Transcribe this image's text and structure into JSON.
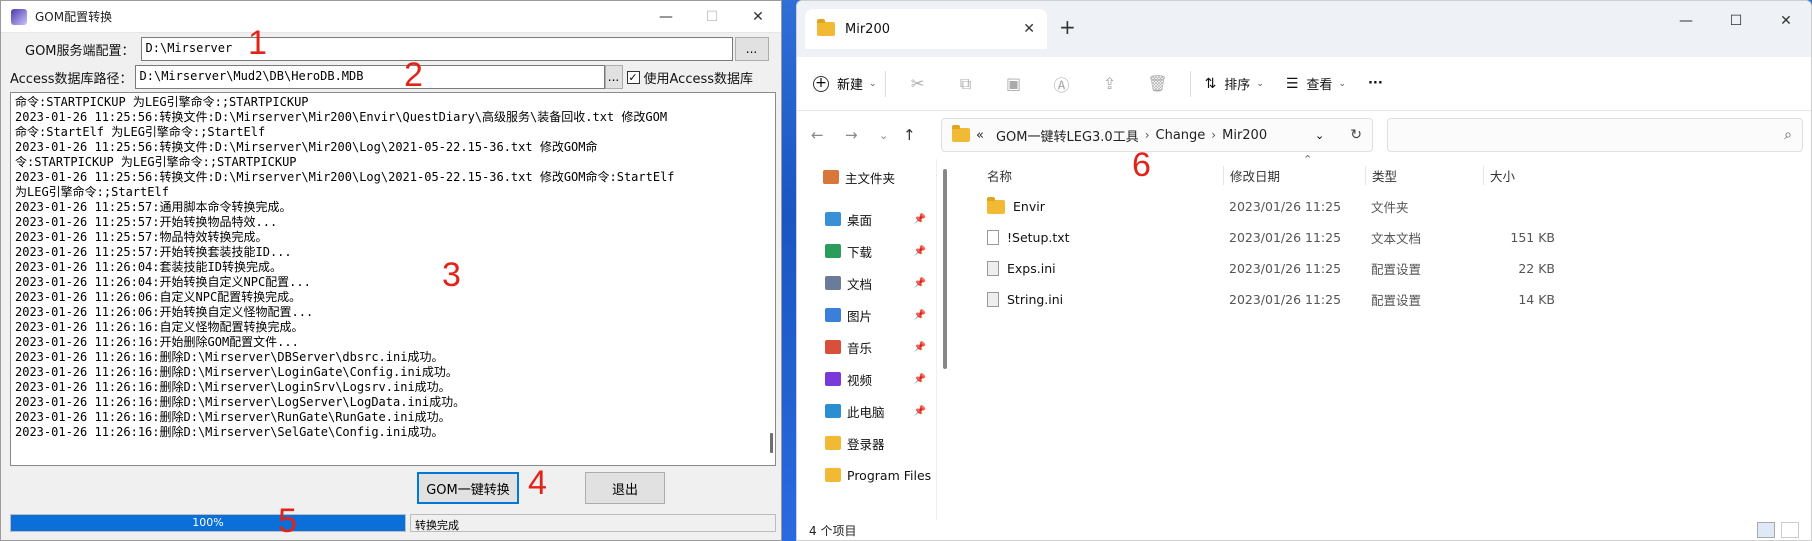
{
  "left_window": {
    "title": "GOM配置转换",
    "caption_minimize": "—",
    "caption_maximize": "☐",
    "caption_close": "✕",
    "server_config_label": "GOM服务端配置：",
    "server_config_value": "D:\\Mirserver",
    "browse_label": "...",
    "access_label": "Access数据库路径：",
    "access_value": "D:\\Mirserver\\Mud2\\DB\\HeroDB.MDB",
    "access_browse_label": "...",
    "use_access_checked": "✓",
    "use_access_label": "使用Access数据库",
    "log_lines": [
      "命令:STARTPICKUP 为LEG引擎命令:;STARTPICKUP",
      "2023-01-26 11:25:56:转换文件:D:\\Mirserver\\Mir200\\Envir\\QuestDiary\\高级服务\\装备回收.txt 修改GOM",
      "命令:StartElf 为LEG引擎命令:;StartElf",
      "2023-01-26 11:25:56:转换文件:D:\\Mirserver\\Mir200\\Log\\2021-05-22.15-36.txt 修改GOM命",
      "令:STARTPICKUP 为LEG引擎命令:;STARTPICKUP",
      "2023-01-26 11:25:56:转换文件:D:\\Mirserver\\Mir200\\Log\\2021-05-22.15-36.txt 修改GOM命令:StartElf",
      "为LEG引擎命令:;StartElf",
      "2023-01-26 11:25:57:通用脚本命令转换完成。",
      "2023-01-26 11:25:57:开始转换物品特效...",
      "2023-01-26 11:25:57:物品特效转换完成。",
      "2023-01-26 11:25:57:开始转换套装技能ID...",
      "2023-01-26 11:26:04:套装技能ID转换完成。",
      "2023-01-26 11:26:04:开始转换自定义NPC配置...",
      "2023-01-26 11:26:06:自定义NPC配置转换完成。",
      "2023-01-26 11:26:06:开始转换自定义怪物配置...",
      "2023-01-26 11:26:16:自定义怪物配置转换完成。",
      "2023-01-26 11:26:16:开始删除GOM配置文件...",
      "2023-01-26 11:26:16:删除D:\\Mirserver\\DBServer\\dbsrc.ini成功。",
      "2023-01-26 11:26:16:删除D:\\Mirserver\\LoginGate\\Config.ini成功。",
      "2023-01-26 11:26:16:删除D:\\Mirserver\\LoginSrv\\Logsrv.ini成功。",
      "2023-01-26 11:26:16:删除D:\\Mirserver\\LogServer\\LogData.ini成功。",
      "2023-01-26 11:26:16:删除D:\\Mirserver\\RunGate\\RunGate.ini成功。",
      "2023-01-26 11:26:16:删除D:\\Mirserver\\SelGate\\Config.ini成功。"
    ],
    "convert_button": "GOM一键转换",
    "exit_button": "退出",
    "progress_value": 1.0,
    "progress_label": "100%",
    "status_text": "转换完成"
  },
  "annotations": [
    "1",
    "2",
    "3",
    "4",
    "5",
    "6"
  ],
  "annotation_color": "#e2231a",
  "right_window": {
    "tab_title": "Mir200",
    "tab_close": "✕",
    "new_tab": "+",
    "caption_minimize": "—",
    "caption_maximize": "☐",
    "caption_close": "✕",
    "toolbar": {
      "new_label": "新建",
      "sort_label": "排序",
      "view_label": "查看",
      "more_label": "···"
    },
    "breadcrumb_prefix": "«",
    "breadcrumbs": [
      "GOM一键转LEG3.0工具",
      "Change",
      "Mir200"
    ],
    "nav_items": [
      {
        "label": "主文件夹",
        "icon": "home-icon",
        "color": "#d9773a"
      },
      {
        "label": "桌面",
        "icon": "desktop-icon",
        "color": "#3a8fd9"
      },
      {
        "label": "下载",
        "icon": "download-icon",
        "color": "#2a9d5a"
      },
      {
        "label": "文档",
        "icon": "document-icon",
        "color": "#6b7b9a"
      },
      {
        "label": "图片",
        "icon": "picture-icon",
        "color": "#3a7fd9"
      },
      {
        "label": "音乐",
        "icon": "music-icon",
        "color": "#d9503a"
      },
      {
        "label": "视频",
        "icon": "video-icon",
        "color": "#7a3ad9"
      },
      {
        "label": "此电脑",
        "icon": "computer-icon",
        "color": "#2a8fd0"
      },
      {
        "label": "登录器",
        "icon": "folder-icon",
        "color": "#f2b935"
      },
      {
        "label": "Program Files",
        "icon": "folder-icon",
        "color": "#f2b935"
      }
    ],
    "columns": {
      "name": "名称",
      "date": "修改日期",
      "type": "类型",
      "size": "大小"
    },
    "files": [
      {
        "name": "Envir",
        "date": "2023/01/26 11:25",
        "type": "文件夹",
        "size": "",
        "icon": "folder-icon"
      },
      {
        "name": "!Setup.txt",
        "date": "2023/01/26 11:25",
        "type": "文本文档",
        "size": "151 KB",
        "icon": "text-file-icon"
      },
      {
        "name": "Exps.ini",
        "date": "2023/01/26 11:25",
        "type": "配置设置",
        "size": "22 KB",
        "icon": "config-file-icon"
      },
      {
        "name": "String.ini",
        "date": "2023/01/26 11:25",
        "type": "配置设置",
        "size": "14 KB",
        "icon": "config-file-icon"
      }
    ],
    "status_count": "4 个项目"
  }
}
